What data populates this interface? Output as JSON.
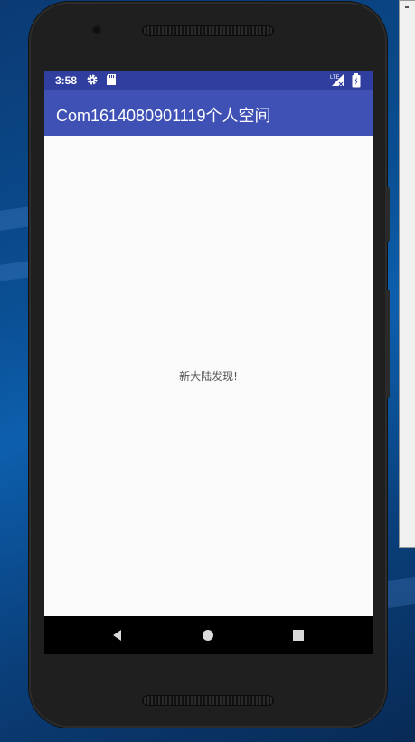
{
  "status_bar": {
    "time": "3:58",
    "icons": [
      "gear-icon",
      "sd-card-icon",
      "lte-signal-icon",
      "battery-charging-icon"
    ],
    "network_label": "LTE"
  },
  "app_bar": {
    "title": "Com1614080901119个人空间"
  },
  "content": {
    "message": "新大陆发现!"
  },
  "nav_bar": {
    "icons": [
      "back-icon",
      "home-icon",
      "recents-icon"
    ]
  },
  "colors": {
    "status_bar": "#303f9f",
    "app_bar": "#3f51b5",
    "screen_background": "#fafafa",
    "nav_bar": "#000000",
    "desktop_background": "#0a4f93"
  }
}
